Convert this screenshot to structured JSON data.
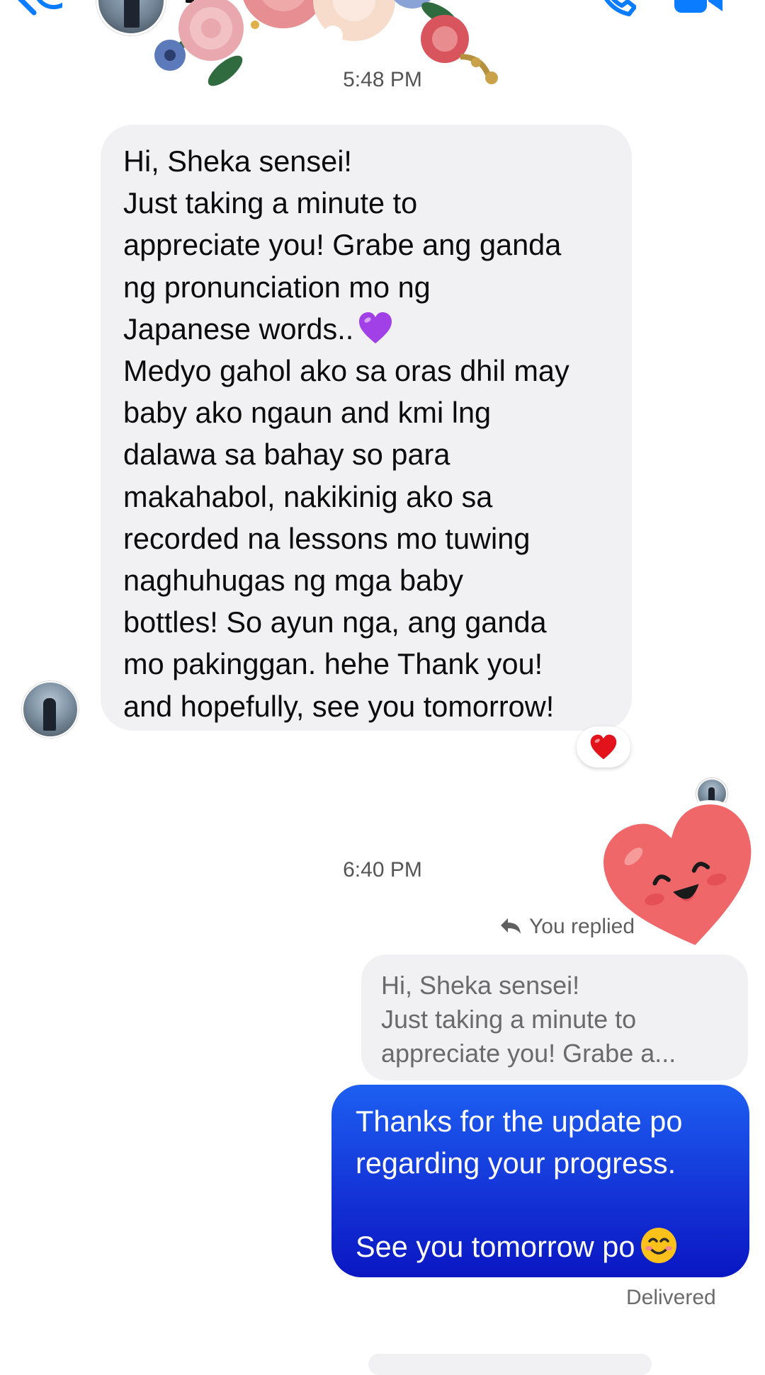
{
  "header": {
    "back_icon": "chevron-left-icon",
    "call_icon": "phone-icon",
    "video_icon": "video-camera-icon"
  },
  "conversation": {
    "timestamp_1": "5:48 PM",
    "incoming_message": {
      "lines": [
        "Hi, Sheka sensei!",
        "Just taking a minute to",
        "appreciate you! Grabe ang ganda",
        "ng pronunciation mo ng",
        "Japanese words..",
        "Medyo gahol ako sa oras dhil may",
        "baby ako ngaun and kmi lng",
        "dalawa sa bahay so para",
        "makahabol, nakikinig ako sa",
        "recorded na lessons mo tuwing",
        "naghuhugas ng mga baby",
        "bottles! So ayun nga, ang ganda",
        "mo pakinggan. hehe Thank you!",
        "and hopefully, see you tomorrow!"
      ],
      "inline_emoji": "purple-heart-icon",
      "reaction_emoji": "red-heart-icon"
    },
    "timestamp_2": "6:40 PM",
    "replied_label": "You replied",
    "quoted_message": {
      "lines": [
        "Hi, Sheka sensei!",
        "Just taking a minute to",
        "appreciate you! Grabe a..."
      ]
    },
    "outgoing_message": {
      "lines": [
        "Thanks for the update po",
        "regarding your progress.",
        "See you tomorrow po"
      ],
      "inline_emoji": "smiling-face-icon"
    },
    "status": "Delivered"
  },
  "colors": {
    "incoming_bubble": "#f1f1f4",
    "outgoing_bubble_top": "#1d5ff1",
    "outgoing_bubble_bottom": "#0a17c2",
    "messenger_blue": "#0a7cff",
    "heart_sticker": "#f0676a"
  }
}
